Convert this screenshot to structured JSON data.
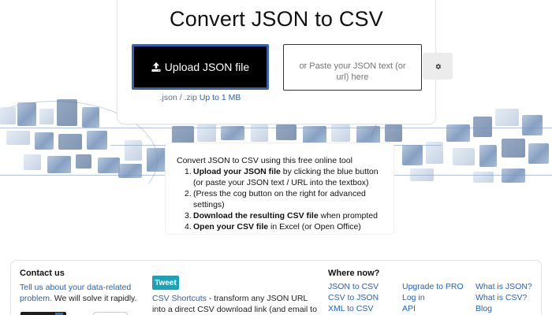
{
  "header": {
    "title": "Convert JSON to CSV"
  },
  "upload": {
    "button_label": "Upload JSON file",
    "hint_formats": ".json / .zip",
    "hint_limit": "Up to 1 MB"
  },
  "paste": {
    "placeholder": "or Paste your JSON text (or url) here"
  },
  "settings": {
    "icon": "gear-icon"
  },
  "instructions": {
    "intro": "Convert JSON to CSV using this free online tool",
    "steps": [
      {
        "num": "1.",
        "bold": "Upload your JSON file",
        "rest": " by clicking the blue button (or paste your JSON text / URL into the textbox)"
      },
      {
        "num": "2.",
        "bold": "",
        "rest": "(Press the cog button on the right for advanced settings)"
      },
      {
        "num": "3.",
        "bold": "Download the resulting CSV file",
        "rest": " when prompted"
      },
      {
        "num": "4.",
        "bold": "Open your CSV file",
        "rest": " in Excel (or Open Office)"
      }
    ]
  },
  "footer": {
    "contact": {
      "heading": "Contact us",
      "link": "Tell us about your data-related problem.",
      "text": " We will solve it rapidly."
    },
    "tweet_label": "Tweet",
    "shortcuts": {
      "link": "CSV Shortcuts",
      "text": " - transform any JSON URL into a direct CSV download link (and email to others)"
    },
    "where_now": {
      "heading": "Where now?",
      "col1": [
        "JSON to CSV",
        "CSV to JSON",
        "XML to CSV"
      ],
      "col2": [
        "Upgrade to PRO",
        "Log in",
        "API"
      ],
      "col3": [
        "What is JSON?",
        "What is CSV?",
        "Blog"
      ]
    }
  },
  "colors": {
    "upload_bg": "#000000",
    "upload_border": "#3b62a8",
    "link": "#2a62b4",
    "tweet": "#1da1b4"
  }
}
